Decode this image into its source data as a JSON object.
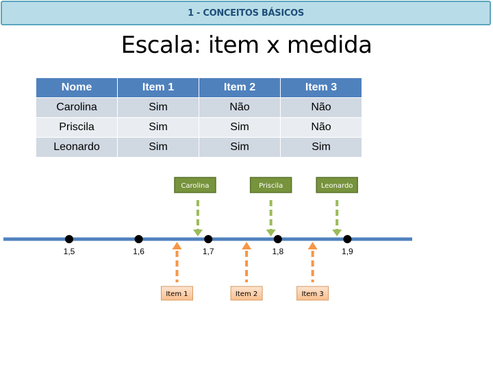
{
  "header": {
    "title": "1 - CONCEITOS BÁSICOS"
  },
  "page_title": "Escala: item x medida",
  "table": {
    "columns": [
      "Nome",
      "Item 1",
      "Item 2",
      "Item 3"
    ],
    "rows": [
      [
        "Carolina",
        "Sim",
        "Não",
        "Não"
      ],
      [
        "Priscila",
        "Sim",
        "Sim",
        "Não"
      ],
      [
        "Leonardo",
        "Sim",
        "Sim",
        "Sim"
      ]
    ]
  },
  "scale": {
    "ticks": [
      {
        "value": 1.5,
        "label": "1,5"
      },
      {
        "value": 1.6,
        "label": "1,6"
      },
      {
        "value": 1.7,
        "label": "1,7"
      },
      {
        "value": 1.8,
        "label": "1,8"
      },
      {
        "value": 1.9,
        "label": "1,9"
      }
    ],
    "persons": [
      {
        "label": "Carolina",
        "value": 1.685
      },
      {
        "label": "Priscila",
        "value": 1.79
      },
      {
        "label": "Leonardo",
        "value": 1.885
      }
    ],
    "items": [
      {
        "label": "Item 1",
        "value": 1.655
      },
      {
        "label": "Item 2",
        "value": 1.755
      },
      {
        "label": "Item 3",
        "value": 1.85
      }
    ],
    "colors": {
      "axis": "#4f81bd",
      "person_box": "#77933c",
      "person_arrow": "#9bbb59",
      "item_box_top": "#fde3cf",
      "item_box_bottom": "#fbbf8c",
      "item_arrow": "#f79646",
      "tick_dot": "#000000"
    }
  }
}
